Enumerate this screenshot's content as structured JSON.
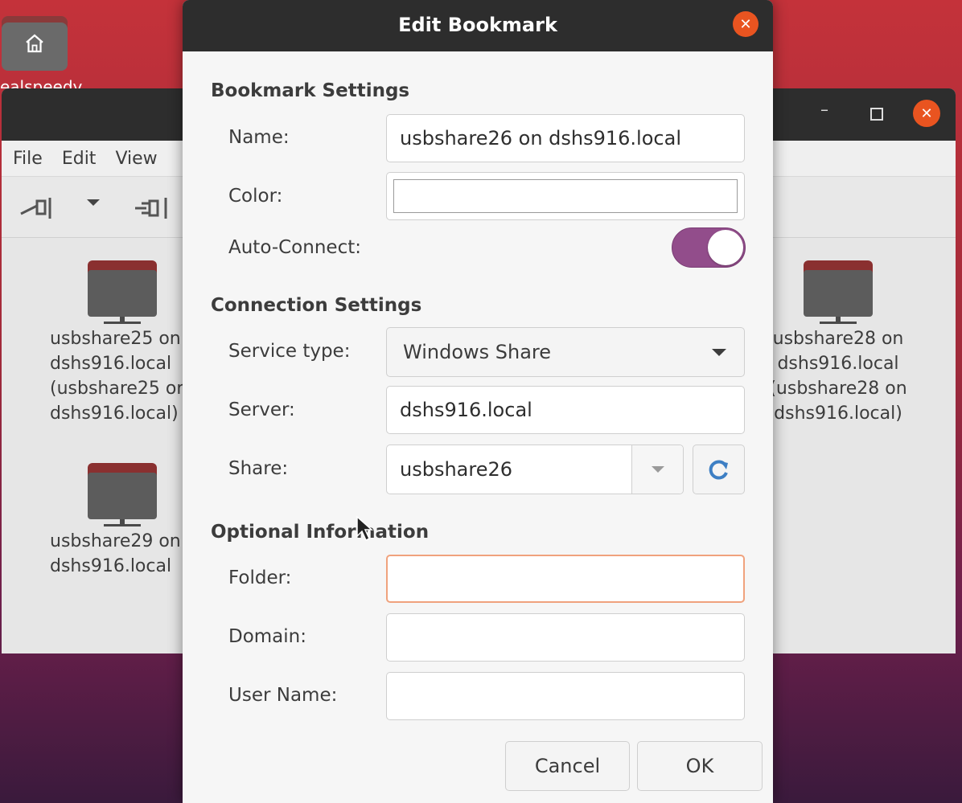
{
  "desktop": {
    "home_label": "ealspeedy"
  },
  "file_manager": {
    "menu": [
      "File",
      "Edit",
      "View"
    ],
    "folders": [
      {
        "name": "usbshare25 on\ndshs916.local\n(usbshare25 on\ndshs916.local)"
      },
      {
        "name": "usbshare28 on\ndshs916.local\n(usbshare28 on\ndshs916.local)"
      },
      {
        "name": "usbshare29 on\ndshs916.local"
      }
    ]
  },
  "dialog": {
    "title": "Edit Bookmark",
    "bookmark_settings": {
      "heading": "Bookmark Settings",
      "name_label": "Name:",
      "name_value": "usbshare26 on dshs916.local",
      "color_label": "Color:",
      "auto_connect_label": "Auto-Connect:",
      "auto_connect_on": true
    },
    "connection_settings": {
      "heading": "Connection Settings",
      "service_type_label": "Service type:",
      "service_type_value": "Windows Share",
      "server_label": "Server:",
      "server_value": "dshs916.local",
      "share_label": "Share:",
      "share_value": "usbshare26"
    },
    "optional_information": {
      "heading": "Optional Information",
      "folder_label": "Folder:",
      "folder_value": "",
      "domain_label": "Domain:",
      "domain_value": "",
      "username_label": "User Name:",
      "username_value": ""
    },
    "buttons": {
      "cancel": "Cancel",
      "ok": "OK"
    }
  },
  "colors": {
    "accent": "#e95420",
    "toggle": "#924d8b",
    "focus_border": "#f0a27d",
    "titlebar": "#2d2d2d"
  }
}
